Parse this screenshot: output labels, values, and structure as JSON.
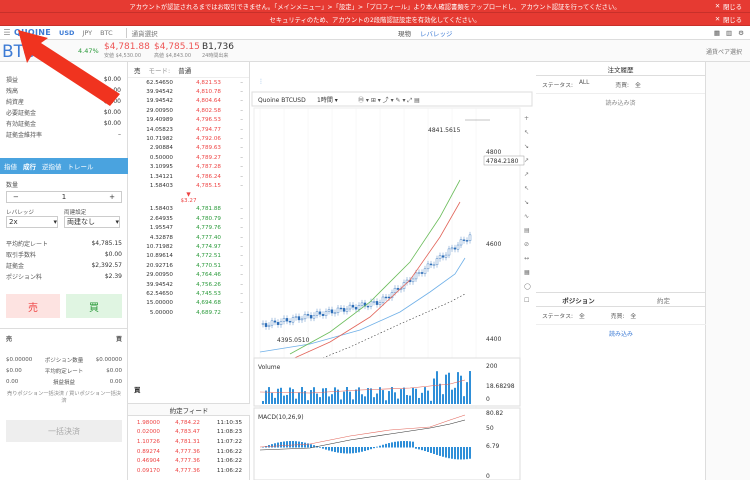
{
  "banners": [
    {
      "text": "アカウントが認証されるまではお取引できません。「メインメニュー」>「設定」>「プロフィール」より本人確認書類をアップロードし、アカウント認証を行ってください。",
      "close": "閉じる"
    },
    {
      "text": "セキュリティのため、アカウントの2段階認証設定を有効化してください。",
      "close": "閉じる"
    }
  ],
  "topbar": {
    "logo": "QUOINE",
    "currencies": [
      "USD",
      "JPY",
      "BTC"
    ],
    "pair_select": "通貨選択",
    "spot": "現物",
    "leverage": "レバレッジ"
  },
  "ticker": {
    "symbol": "BTC",
    "change": "4.47%",
    "last_price": "$4,781.88",
    "last_sub": "安値 $4,530.00",
    "high_price": "$4,785.15",
    "high_sub": "高値 $4,843.00",
    "volume": "B1,736",
    "volume_sub": "24時間出来",
    "pair_label": "通貨ペア選択"
  },
  "account": {
    "rows": [
      {
        "k": "損益",
        "v": "$0.00"
      },
      {
        "k": "残高",
        "v": "$0.00"
      },
      {
        "k": "純資産",
        "v": "$0.00"
      },
      {
        "k": "必要証拠金",
        "v": "$0.00"
      },
      {
        "k": "有効証拠金",
        "v": "$0.00"
      },
      {
        "k": "証拠金維持率",
        "v": "–"
      }
    ]
  },
  "order_form": {
    "tabs": [
      "指値",
      "成行",
      "逆指値",
      "トレール"
    ],
    "quantity_label": "数量",
    "quantity": "1",
    "leverage_label": "レバレッジ",
    "leverage": "2x",
    "both_label": "両建設定",
    "both": "両建なし",
    "rows": [
      {
        "k": "平均約定レート",
        "v": "$4,785.15"
      },
      {
        "k": "取引手数料",
        "v": "$0.00"
      },
      {
        "k": "証拠金",
        "v": "$2,392.57"
      },
      {
        "k": "ポジション料",
        "v": "$2.39"
      }
    ],
    "sell": "売",
    "buy": "買"
  },
  "positions_mini": {
    "sell_head": "売",
    "buy_head": "買",
    "rows": [
      {
        "l": "$0.00000",
        "m": "ポジション数量",
        "r": "$0.00000"
      },
      {
        "l": "$0.00",
        "m": "平均約定レート",
        "r": "$0.00"
      },
      {
        "l": "0.00",
        "m": "損益損益",
        "r": "0.00"
      }
    ],
    "close_label": "売りポジション一括決済 / 買いポジション一括決済",
    "bulk": "一括決済"
  },
  "orderbook": {
    "title": "売",
    "mode_label": "モード:",
    "mode": "普通",
    "sells": [
      {
        "q": "62.54650",
        "p": "4,821.53"
      },
      {
        "q": "39.94542",
        "p": "4,810.78"
      },
      {
        "q": "19.94542",
        "p": "4,804.64"
      },
      {
        "q": "29.00950",
        "p": "4,802.58"
      },
      {
        "q": "19.40989",
        "p": "4,796.53"
      },
      {
        "q": "14.05823",
        "p": "4,794.77"
      },
      {
        "q": "10.71982",
        "p": "4,792.06"
      },
      {
        "q": "2.90884",
        "p": "4,789.63"
      },
      {
        "q": "0.50000",
        "p": "4,789.27"
      },
      {
        "q": "3.10995",
        "p": "4,787.28"
      },
      {
        "q": "1.34121",
        "p": "4,786.24"
      },
      {
        "q": "1.58403",
        "p": "4,785.15"
      }
    ],
    "spread": "$3.27",
    "buys": [
      {
        "q": "1.58403",
        "p": "4,781.88"
      },
      {
        "q": "2.64935",
        "p": "4,780.79"
      },
      {
        "q": "1.95547",
        "p": "4,779.76"
      },
      {
        "q": "4.32878",
        "p": "4,777.40"
      },
      {
        "q": "10.71982",
        "p": "4,774.97"
      },
      {
        "q": "10.89614",
        "p": "4,772.51"
      },
      {
        "q": "20.92716",
        "p": "4,770.51"
      },
      {
        "q": "29.00950",
        "p": "4,764.46"
      },
      {
        "q": "39.94542",
        "p": "4,756.26"
      },
      {
        "q": "62.54650",
        "p": "4,745.53"
      },
      {
        "q": "15.00000",
        "p": "4,694.68"
      },
      {
        "q": "5.00000",
        "p": "4,689.72"
      }
    ],
    "buy_head": "買",
    "feed_title": "約定フィード",
    "feed": [
      {
        "a": "1.98000",
        "b": "4,784.22",
        "c": "11:10:35"
      },
      {
        "a": "0.02000",
        "b": "4,783.47",
        "c": "11:08:23"
      },
      {
        "a": "1.10726",
        "b": "4,781.31",
        "c": "11:07:22"
      },
      {
        "a": "0.89274",
        "b": "4,777.36",
        "c": "11:06:22"
      },
      {
        "a": "0.46904",
        "b": "4,777.36",
        "c": "11:06:22"
      },
      {
        "a": "0.09170",
        "b": "4,777.36",
        "c": "11:06:22"
      }
    ]
  },
  "chart": {
    "title": "Quoine BTCUSD",
    "interval": "1時間",
    "labels": {
      "high": "4841.5615",
      "low": "4395.0510",
      "p4800": "4800",
      "p4784": "4784.2180",
      "p4600": "4600",
      "p4400": "4400",
      "volume": "Volume",
      "v200": "200",
      "v18": "18.68298",
      "v0": "0",
      "macd": "MACD(10,26,9)",
      "m80": "80.82",
      "m50": "50",
      "m6": "6.79",
      "m0": "0"
    }
  },
  "orders_panel": {
    "title": "注文履歴",
    "status_label": "ステータス:",
    "status": "ALL",
    "side_label": "売買:",
    "side": "全",
    "loading": "読み込み済"
  },
  "positions_panel": {
    "title": "ポジション",
    "executed": "約定",
    "status_label": "ステータス:",
    "status": "全",
    "side_label": "売買:",
    "side": "全",
    "loading": "読み込み"
  },
  "colors": {
    "banner": "#e63a32",
    "brand": "#3d7bd5",
    "sell": "#e44444",
    "buy": "#2a9a3a",
    "arrow": "#f0331f"
  }
}
